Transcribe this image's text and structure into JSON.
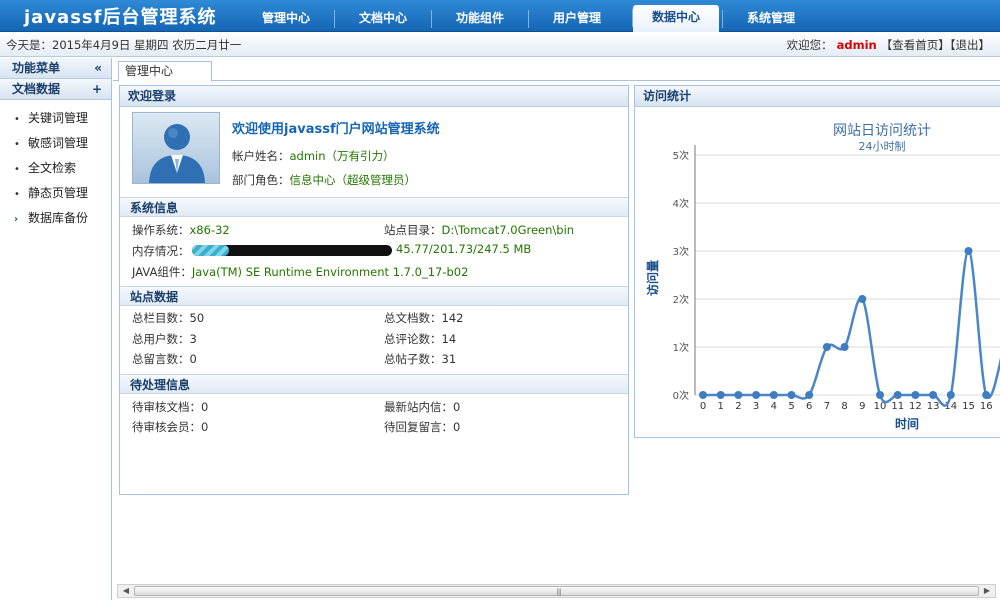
{
  "app": {
    "title": "javassf后台管理系统"
  },
  "nav": {
    "tabs": [
      "管理中心",
      "文档中心",
      "功能组件",
      "用户管理",
      "数据中心",
      "系统管理"
    ],
    "active_index": 4
  },
  "infobar": {
    "today": "今天是：2015年4月9日 星期四 农历二月廿一",
    "welcome_prefix": "欢迎您：",
    "username": "admin",
    "home_link": "【查看首页】",
    "logout_link": "【退出】"
  },
  "sidebar": {
    "menu_title": "功能菜单",
    "collapse_icon": "«",
    "group_title": "文档数据",
    "group_icon": "+",
    "items": [
      "关键词管理",
      "敏感词管理",
      "全文检索",
      "静态页管理",
      "数据库备份"
    ]
  },
  "main": {
    "tab_label": "管理中心"
  },
  "welcome_panel": {
    "title": "欢迎登录",
    "heading": "欢迎使用javassf门户网站管理系统",
    "account_label": "帐户姓名：",
    "account_value": "admin（万有引力）",
    "role_label": "部门角色：",
    "role_value": "信息中心（超级管理员）"
  },
  "system_info": {
    "title": "系统信息",
    "os_label": "操作系统：",
    "os_value": "x86-32",
    "site_dir_label": "站点目录：",
    "site_dir_value": "D:\\Tomcat7.0Green\\bin",
    "memory_label": "内存情况：",
    "memory_value": "45.77/201.73/247.5 MB",
    "memory_fraction": 0.185,
    "java_label": "JAVA组件：",
    "java_value": "Java(TM) SE Runtime Environment 1.7.0_17-b02"
  },
  "site_data": {
    "title": "站点数据",
    "items": [
      {
        "label": "总栏目数：",
        "value": "50"
      },
      {
        "label": "总文档数：",
        "value": "142"
      },
      {
        "label": "总用户数：",
        "value": "3"
      },
      {
        "label": "总评论数：",
        "value": "14"
      },
      {
        "label": "总留言数：",
        "value": "0"
      },
      {
        "label": "总帖子数：",
        "value": "31"
      }
    ]
  },
  "pending": {
    "title": "待处理信息",
    "items": [
      {
        "label": "待审核文档：",
        "value": "0"
      },
      {
        "label": "最新站内信：",
        "value": "0"
      },
      {
        "label": "待审核会员：",
        "value": "0"
      },
      {
        "label": "待回复留言：",
        "value": "0"
      }
    ]
  },
  "stats_panel": {
    "title": "访问统计"
  },
  "chart_data": {
    "type": "line",
    "title": "网站日访问统计",
    "subtitle": "24小时制",
    "xlabel": "时间",
    "ylabel": "访问量",
    "y_unit": "次",
    "categories": [
      "0",
      "1",
      "2",
      "3",
      "4",
      "5",
      "6",
      "7",
      "8",
      "9",
      "10",
      "11",
      "12",
      "13",
      "14",
      "15",
      "16"
    ],
    "series": [
      {
        "values": [
          0,
          0,
          0,
          0,
          0,
          0,
          0,
          1,
          1,
          2,
          0,
          0,
          0,
          0,
          0,
          3,
          0
        ]
      }
    ],
    "ylim": [
      0,
      5
    ],
    "y_ticks": [
      0,
      1,
      2,
      3,
      4,
      5
    ],
    "grid": true,
    "colors": {
      "line": "#4a86c8",
      "point": "#3f7cc2",
      "title": "#3d6fa8"
    }
  }
}
